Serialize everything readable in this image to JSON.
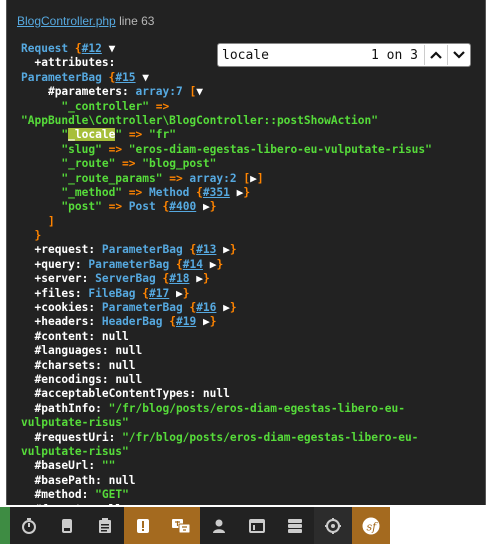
{
  "file": {
    "name": "BlogController.php",
    "line": "line 63"
  },
  "search": {
    "value": "locale",
    "count": "1 on 3"
  },
  "colors": {
    "panel_bg": "#222222",
    "blue": "#56a9e0",
    "orange": "#ff8400",
    "green": "#56db3a",
    "highlight": "#a7bf3a",
    "toolbar_orange": "#a46a1f"
  },
  "dump": {
    "request": "Request",
    "request_ref": "#12",
    "attributes": "+attributes",
    "parameter_bag": "ParameterBag",
    "attributes_ref": "#15",
    "parameters": "#parameters",
    "array7": "array:7",
    "controller_key": "\"_controller\"",
    "controller_val": "\"AppBundle\\Controller\\BlogController::postShowAction\"",
    "locale_key": "_locale",
    "locale_val": "\"fr\"",
    "slug_key": "\"slug\"",
    "slug_val": "\"eros-diam-egestas-libero-eu-vulputate-risus\"",
    "route_key": "\"_route\"",
    "route_val": "\"blog_post\"",
    "route_params_key": "\"_route_params\"",
    "array2": "array:2",
    "method_key": "\"_method\"",
    "method_class": "Method",
    "method_ref": "#351",
    "post_key": "\"post\"",
    "post_class": "Post",
    "post_ref": "#400",
    "request_prop": "+request",
    "request_prop_ref": "#13",
    "query_prop": "+query",
    "query_ref": "#14",
    "server_prop": "+server",
    "server_class": "ServerBag",
    "server_ref": "#18",
    "files_prop": "+files",
    "files_class": "FileBag",
    "files_ref": "#17",
    "cookies_prop": "+cookies",
    "cookies_ref": "#16",
    "headers_prop": "+headers",
    "headers_class": "HeaderBag",
    "headers_ref": "#19",
    "content": "#content",
    "languages": "#languages",
    "charsets": "#charsets",
    "encodings": "#encodings",
    "acceptable": "#acceptableContentTypes",
    "null": "null",
    "pathinfo": "#pathInfo",
    "pathinfo_val1": "\"/fr/blog/posts/eros-diam-egestas-libero-eu-",
    "pathinfo_val2": "vulputate-risus\"",
    "requesturi": "#requestUri",
    "requesturi_val1": "\"/fr/blog/posts/eros-diam-egestas-libero-eu-",
    "requesturi_val2": "vulputate-risus\"",
    "baseurl": "#baseUrl",
    "baseurl_val": "\"\"",
    "basepath": "#basePath",
    "method_prop": "#method",
    "method_prop_val": "\"GET\"",
    "format": "#format"
  },
  "toolbar": {
    "icons": [
      "timer-icon",
      "database-icon",
      "forms-icon",
      "exception-icon",
      "translation-icon",
      "user-icon",
      "layout-icon",
      "server-icon",
      "target-icon",
      "symfony-icon"
    ]
  }
}
